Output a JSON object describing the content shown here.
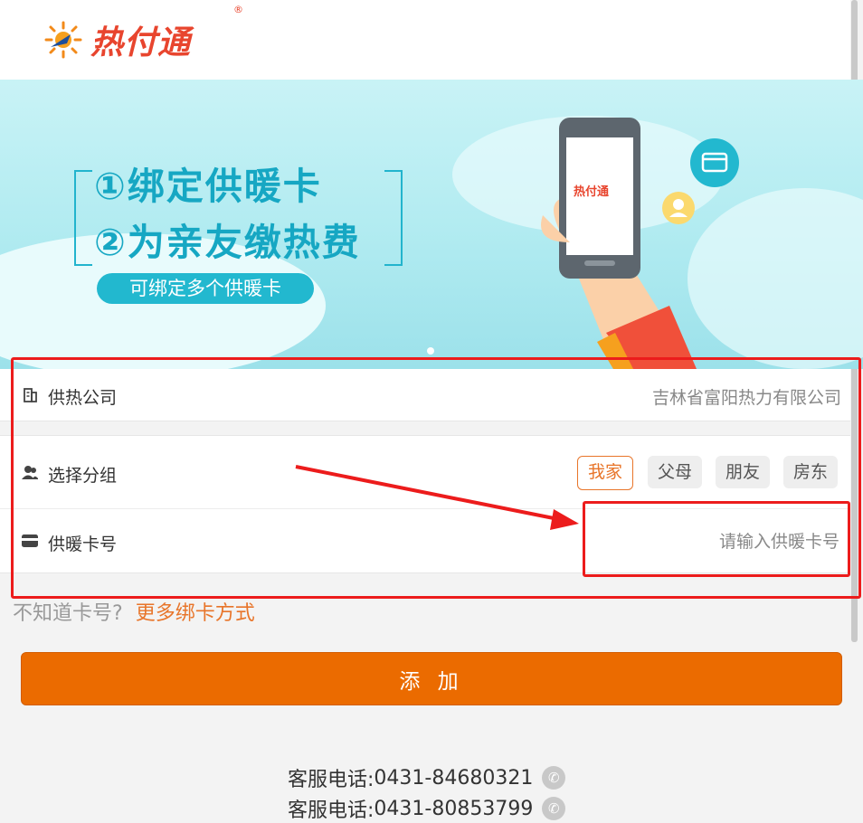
{
  "header": {
    "logo_text": "热付通",
    "logo_reg": "®"
  },
  "banner": {
    "line1": "①绑定供暖卡",
    "line2": "②为亲友缴热费",
    "pill": "可绑定多个供暖卡",
    "phone_logo": "热付通"
  },
  "form": {
    "company": {
      "label": "供热公司",
      "value": "吉林省富阳热力有限公司",
      "icon": "building-icon"
    },
    "group": {
      "label": "选择分组",
      "icon": "users-icon",
      "options": [
        "我家",
        "父母",
        "朋友",
        "房东"
      ],
      "selected": "我家"
    },
    "card": {
      "label": "供暖卡号",
      "placeholder": "请输入供暖卡号",
      "icon": "card-icon"
    }
  },
  "hint": {
    "text": "不知道卡号?",
    "link": "更多绑卡方式"
  },
  "add_button": "添 加",
  "phones": [
    {
      "label": "客服电话:",
      "number": "0431-84680321"
    },
    {
      "label": "客服电话:",
      "number": "0431-80853799"
    }
  ],
  "colors": {
    "accent": "#eb6b00",
    "annotation": "#ec1c1c",
    "banner": "#aeeaf0"
  }
}
